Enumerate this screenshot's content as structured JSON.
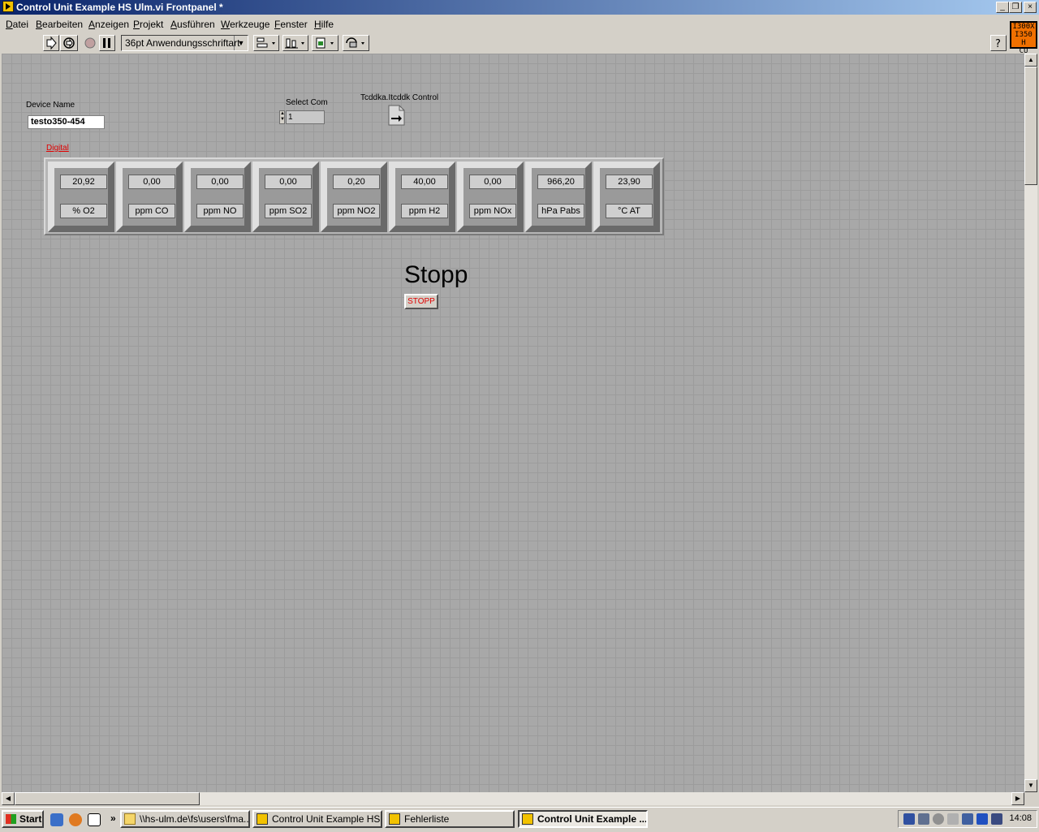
{
  "window": {
    "title": "Control Unit Example HS Ulm.vi Frontpanel *",
    "buttons": [
      "_",
      "❐",
      "×"
    ]
  },
  "menu": [
    {
      "label": "Datei",
      "accel": "D",
      "rest": "atei"
    },
    {
      "label": "Bearbeiten",
      "accel": "B",
      "rest": "earbeiten"
    },
    {
      "label": "Anzeigen",
      "accel": "A",
      "rest": "nzeigen"
    },
    {
      "label": "Projekt",
      "accel": "P",
      "rest": "rojekt"
    },
    {
      "label": "Ausführen",
      "accel": "A",
      "rest": "usführen"
    },
    {
      "label": "Werkzeuge",
      "accel": "W",
      "rest": "erkzeuge"
    },
    {
      "label": "Fenster",
      "accel": "F",
      "rest": "enster"
    },
    {
      "label": "Hilfe",
      "accel": "H",
      "rest": "ilfe"
    }
  ],
  "toolbar": {
    "font_select": "36pt Anwendungsschriftart",
    "icons": [
      "run-arrow-icon",
      "run-continuously-icon",
      "abort-icon",
      "pause-icon",
      "align-objects-icon",
      "distribute-objects-icon",
      "resize-objects-icon",
      "reorder-icon",
      "help-icon"
    ]
  },
  "corner_icon": [
    "I300X",
    "I350 H",
    "CU"
  ],
  "panel": {
    "device_name_label": "Device Name",
    "device_name_value": "testo350-454",
    "select_com_label": "Select Com",
    "select_com_value": "1",
    "refnum_label": "Tcddka.Itcddk Control",
    "cluster_label": "Digital",
    "readings": [
      {
        "value": "20,92",
        "unit": "% O2"
      },
      {
        "value": "0,00",
        "unit": "ppm CO"
      },
      {
        "value": "0,00",
        "unit": "ppm NO"
      },
      {
        "value": "0,00",
        "unit": "ppm SO2"
      },
      {
        "value": "0,20",
        "unit": "ppm NO2"
      },
      {
        "value": "40,00",
        "unit": "ppm H2"
      },
      {
        "value": "0,00",
        "unit": "ppm NOx"
      },
      {
        "value": "966,20",
        "unit": "hPa Pabs"
      },
      {
        "value": "23,90",
        "unit": "°C AT"
      }
    ],
    "stop_caption": "Stopp",
    "stop_button": "STOPP"
  },
  "taskbar": {
    "start": "Start",
    "overflow": "»",
    "tasks": [
      {
        "label": "\\\\hs-ulm.de\\fs\\users\\fma...",
        "active": false
      },
      {
        "label": "Control Unit Example HS ...",
        "active": false
      },
      {
        "label": "Fehlerliste",
        "active": false
      },
      {
        "label": "Control Unit Example ...",
        "active": true
      }
    ],
    "clock": "14:08"
  }
}
